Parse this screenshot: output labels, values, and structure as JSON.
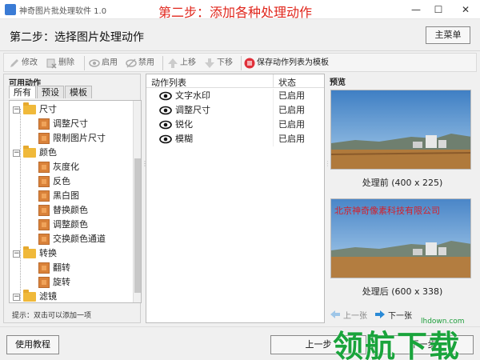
{
  "window": {
    "app_title": "神奇图片批处理软件 1.0",
    "overlay_title": "第二步：添加各种处理动作",
    "min_label": "—",
    "max_label": "☐",
    "close_label": "✕"
  },
  "step": {
    "title": "第二步：选择图片处理动作",
    "home_button": "主菜单"
  },
  "toolbar": {
    "edit": "修改",
    "delete": "删除",
    "enable": "启用",
    "disable": "禁用",
    "move_up": "上移",
    "move_down": "下移",
    "save_template": "保存动作列表为模板"
  },
  "left_panel": {
    "label": "可用动作",
    "tabs": [
      "所有",
      "预设",
      "模板"
    ],
    "tree": [
      {
        "label": "尺寸",
        "level": 0
      },
      {
        "label": "调整尺寸",
        "level": 1
      },
      {
        "label": "限制图片尺寸",
        "level": 1
      },
      {
        "label": "颜色",
        "level": 0
      },
      {
        "label": "灰度化",
        "level": 1
      },
      {
        "label": "反色",
        "level": 1
      },
      {
        "label": "黑白图",
        "level": 1
      },
      {
        "label": "替换颜色",
        "level": 1
      },
      {
        "label": "调整颜色",
        "level": 1
      },
      {
        "label": "交换颜色通道",
        "level": 1
      },
      {
        "label": "转换",
        "level": 0
      },
      {
        "label": "翻转",
        "level": 1
      },
      {
        "label": "旋转",
        "level": 1
      },
      {
        "label": "滤镜",
        "level": 0
      }
    ],
    "hint": "提示：双击可以添加一项"
  },
  "action_list": {
    "col_name": "动作列表",
    "col_state": "状态",
    "rows": [
      {
        "name": "文字水印",
        "state": "已启用"
      },
      {
        "name": "调整尺寸",
        "state": "已启用"
      },
      {
        "name": "锐化",
        "state": "已启用"
      },
      {
        "name": "模糊",
        "state": "已启用"
      }
    ]
  },
  "preview": {
    "label": "预览",
    "before_caption": "处理前 (400 x 225)",
    "after_caption": "处理后 (600 x 338)",
    "watermark_text": "北京神奇像素科技有限公司",
    "prev_label": "上一张",
    "next_label": "下一张"
  },
  "bottom": {
    "help_button": "使用教程",
    "prev_button": "上一步",
    "next_button": "下一步"
  },
  "site_watermark": {
    "text": "领航下载",
    "url": "lhdown.com"
  },
  "colors": {
    "accent_red": "#e0261c",
    "folder": "#f0b93a",
    "brand_green": "#1aa43c"
  }
}
